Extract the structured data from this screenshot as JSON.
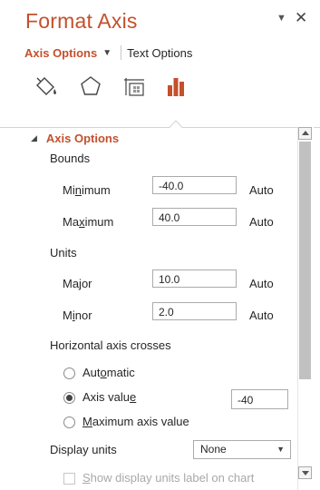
{
  "header": {
    "title": "Format Axis",
    "dropdown_icon": "caret-down-icon",
    "close_icon": "close-icon"
  },
  "tabs": {
    "axis_options": "Axis Options",
    "text_options": "Text Options"
  },
  "category_icons": [
    {
      "name": "fill-line-icon"
    },
    {
      "name": "effects-icon"
    },
    {
      "name": "size-properties-icon"
    },
    {
      "name": "axis-options-icon",
      "active": true
    }
  ],
  "section": {
    "title": "Axis Options",
    "expanded": true
  },
  "bounds": {
    "label": "Bounds",
    "minimum": {
      "label_pre": "Mi",
      "label_key": "n",
      "label_post": "imum",
      "value": "-40.0",
      "auto": "Auto"
    },
    "maximum": {
      "label_pre": "Ma",
      "label_key": "x",
      "label_post": "imum",
      "value": "40.0",
      "auto": "Auto"
    }
  },
  "units": {
    "label": "Units",
    "major": {
      "label": "Major",
      "value": "10.0",
      "auto": "Auto"
    },
    "minor": {
      "label_pre": "M",
      "label_key": "i",
      "label_post": "nor",
      "value": "2.0",
      "auto": "Auto"
    }
  },
  "crosses": {
    "label": "Horizontal axis crosses",
    "automatic": {
      "label_pre": "Aut",
      "label_key": "o",
      "label_post": "matic"
    },
    "axis_value": {
      "label_pre": "Axis valu",
      "label_key": "e",
      "label_post": "",
      "value": "-40"
    },
    "maximum": {
      "label_pre": "",
      "label_key": "M",
      "label_post": "aximum axis value"
    },
    "selected": "axis_value"
  },
  "display_units": {
    "label": "Display units",
    "value": "None"
  },
  "show_units_label": {
    "label_pre": "",
    "label_key": "S",
    "label_post": "how display units label on chart",
    "checked": false,
    "enabled": false
  },
  "colors": {
    "accent": "#c4502c",
    "text": "#262626",
    "disabled": "#a8a8a8"
  }
}
